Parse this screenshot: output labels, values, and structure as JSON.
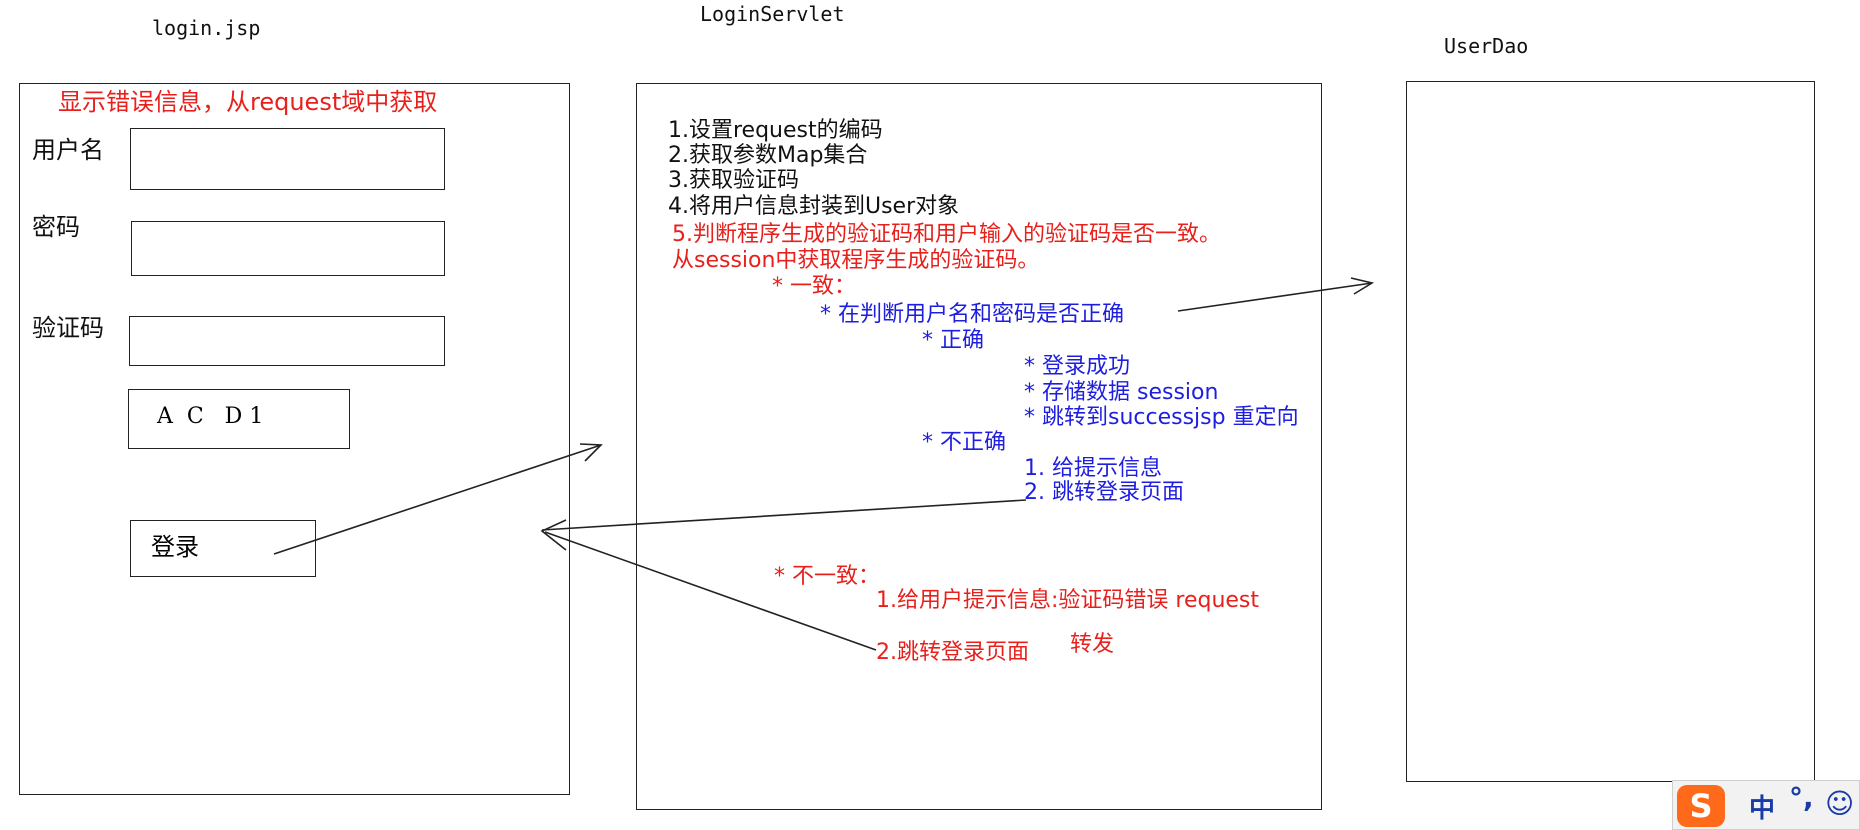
{
  "columns": {
    "login_jsp": {
      "title": "login.jsp"
    },
    "login_servlet": {
      "title": "LoginServlet"
    },
    "user_dao": {
      "title": "UserDao"
    }
  },
  "login_form": {
    "error_note": "显示错误信息，从request域中获取",
    "username_label": "用户名",
    "password_label": "密码",
    "captcha_label": "验证码",
    "captcha_text": "A  C   D 1",
    "login_button": "登录"
  },
  "servlet_steps": {
    "step1": "1.设置request的编码",
    "step2": "2.获取参数Map集合",
    "step3": "3.获取验证码",
    "step4": "4.将用户信息封装到User对象",
    "step5_line1": "5.判断程序生成的验证码和用户输入的验证码是否一致。",
    "step5_line2": "从session中获取程序生成的验证码。",
    "consistent": "* 一致：",
    "check_user": "* 在判断用户名和密码是否正确",
    "correct": "* 正确",
    "login_success": "* 登录成功",
    "store_session": "* 存储数据 session",
    "redirect": "* 跳转到successjsp 重定向",
    "incorrect": "* 不正确",
    "incorrect_step1": "1. 给提示信息",
    "incorrect_step2": "2. 跳转登录页面",
    "inconsistent": "* 不一致：",
    "inconsistent_step1": "1.给用户提示信息:验证码错误 request",
    "inconsistent_step2": "2.跳转登录页面",
    "forward_note": "转发"
  },
  "ime_toolbar": {
    "logo": "S",
    "mode": "中",
    "punct": "°,",
    "emoji": "☺"
  },
  "colors": {
    "red": "#e8201c",
    "blue": "#1e1ee0",
    "ime_orange": "#ff6a1a"
  }
}
